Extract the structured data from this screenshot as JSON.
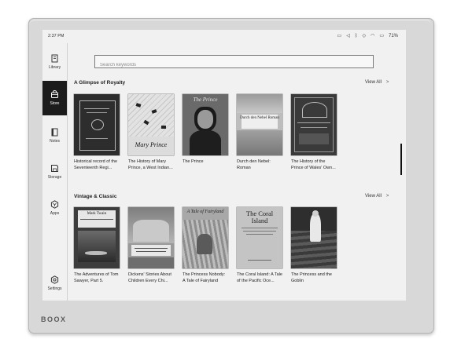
{
  "device": {
    "brand": "BOOX"
  },
  "status": {
    "time": "2:37 PM",
    "battery": "71%"
  },
  "search": {
    "placeholder": "Search keywords"
  },
  "sidebar": {
    "items": [
      {
        "label": "Library",
        "icon": "book-icon",
        "active": false
      },
      {
        "label": "Store",
        "icon": "store-icon",
        "active": true
      },
      {
        "label": "Notes",
        "icon": "notes-icon",
        "active": false
      },
      {
        "label": "Storage",
        "icon": "storage-icon",
        "active": false
      },
      {
        "label": "Apps",
        "icon": "apps-icon",
        "active": false
      },
      {
        "label": "Settings",
        "icon": "settings-icon",
        "active": false
      }
    ]
  },
  "sections": [
    {
      "title": "A Glimpse of Royalty",
      "view_all": "View All",
      "books": [
        {
          "title": "Historical record of the Seventeenth Regi..."
        },
        {
          "title": "The History of Mary Prince, a West Indian...",
          "cover_text": "Mary Prince"
        },
        {
          "title": "The Prince",
          "cover_text": "The Prince"
        },
        {
          "title": "Durch den Nebel: Roman",
          "cover_text": "Durch den Nebel Roman"
        },
        {
          "title": "The History of the Prince of Wales' Own..."
        }
      ]
    },
    {
      "title": "Vintage & Classic",
      "view_all": "View All",
      "books": [
        {
          "title": "The Adventures of Tom Sawyer, Part 5.",
          "cover_text": "Mark Twain"
        },
        {
          "title": "Dickens' Stories About Children Every Chi..."
        },
        {
          "title": "The Princess Nobody: A Tale of Fairyland",
          "cover_text": "A Tale of Fairyland"
        },
        {
          "title": "The Coral Island: A Tale of the Pacific Oce...",
          "cover_text": "The Coral Island"
        },
        {
          "title": "The Princess and the Goblin"
        }
      ]
    }
  ],
  "colors": {
    "screen": "#f1f1f1",
    "active_nav": "#1c1c1c",
    "device_frame": "#d8d8d8"
  }
}
